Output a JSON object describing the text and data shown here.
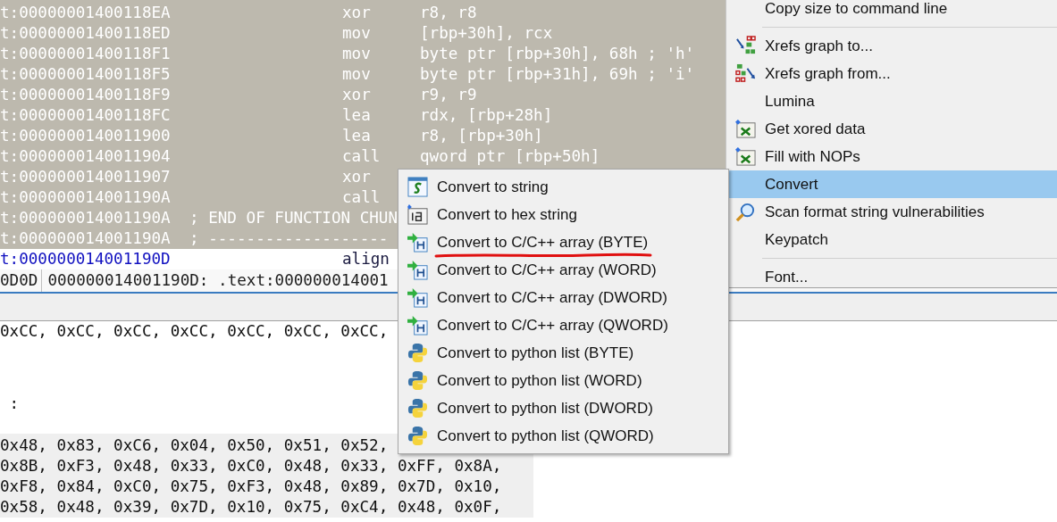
{
  "listing": {
    "rows": [
      {
        "address": "t:00000001400118EA",
        "mnemonic": "xor",
        "operands": "r8, r8",
        "selected": false
      },
      {
        "address": "t:00000001400118ED",
        "mnemonic": "mov",
        "operands": "[rbp+30h], rcx",
        "selected": false
      },
      {
        "address": "t:00000001400118F1",
        "mnemonic": "mov",
        "operands": "byte ptr [rbp+30h], 68h ; 'h'",
        "selected": false
      },
      {
        "address": "t:00000001400118F5",
        "mnemonic": "mov",
        "operands": "byte ptr [rbp+31h], 69h ; 'i'",
        "selected": false
      },
      {
        "address": "t:00000001400118F9",
        "mnemonic": "xor",
        "operands": "r9, r9",
        "selected": false
      },
      {
        "address": "t:00000001400118FC",
        "mnemonic": "lea",
        "operands": "rdx, [rbp+28h]",
        "selected": false
      },
      {
        "address": "t:0000000140011900",
        "mnemonic": "lea",
        "operands": "r8, [rbp+30h]",
        "selected": false
      },
      {
        "address": "t:0000000140011904",
        "mnemonic": "call",
        "operands": "qword ptr [rbp+50h]",
        "selected": false
      },
      {
        "address": "t:0000000140011907",
        "mnemonic": "xor",
        "selected": false
      },
      {
        "address": "t:000000014001190A",
        "mnemonic": "call",
        "selected": false
      },
      {
        "address": "t:000000014001190A",
        "comment": "; END OF FUNCTION CHUN",
        "selected": false
      },
      {
        "address": "t:000000014001190A",
        "comment": "; -------------------",
        "selected": false
      },
      {
        "address": "t:000000014001190D",
        "mnemonic": "align",
        "selected": true
      }
    ]
  },
  "status_line": {
    "offset": "0D0D",
    "location": "000000014001190D: .text:000000014001"
  },
  "output": {
    "lines": [
      "0xCC, 0xCC, 0xCC, 0xCC, 0xCC, 0xCC, 0xCC,",
      " :"
    ],
    "hex_rows": [
      "0x48, 0x83, 0xC6, 0x04, 0x50, 0x51, 0x52,",
      "0x8B, 0xF3, 0x48, 0x33, 0xC0, 0x48, 0x33, 0xFF, 0x8A,",
      "0xF8, 0x84, 0xC0, 0x75, 0xF3, 0x48, 0x89, 0x7D, 0x10,",
      "0x58, 0x48, 0x39, 0x7D, 0x10, 0x75, 0xC4, 0x48, 0x0F,"
    ]
  },
  "context_menu": {
    "items": [
      {
        "kind": "plain",
        "label": "Copy size to command line",
        "selected": false
      },
      {
        "kind": "separator"
      },
      {
        "kind": "graph_to",
        "label": "Xrefs graph to...",
        "selected": false
      },
      {
        "kind": "graph_from",
        "label": "Xrefs graph from...",
        "selected": false
      },
      {
        "kind": "plain",
        "label": "Lumina",
        "selected": false
      },
      {
        "kind": "patch",
        "label": "Get xored data",
        "selected": false
      },
      {
        "kind": "patch",
        "label": "Fill with NOPs",
        "selected": false
      },
      {
        "kind": "plain",
        "label": "Convert",
        "selected": true
      },
      {
        "kind": "search",
        "label": "Scan format string vulnerabilities",
        "selected": false
      },
      {
        "kind": "plain",
        "label": "Keypatch",
        "selected": false
      },
      {
        "kind": "separator"
      },
      {
        "kind": "plain",
        "label": "Font...",
        "selected": false
      }
    ]
  },
  "submenu": {
    "items": [
      {
        "kind": "string",
        "label": "Convert to string",
        "underlined": false
      },
      {
        "kind": "hex",
        "label": "Convert to hex string",
        "underlined": false
      },
      {
        "kind": "array",
        "label": "Convert to C/C++ array (BYTE)",
        "underlined": true
      },
      {
        "kind": "array",
        "label": "Convert to C/C++ array (WORD)",
        "underlined": false
      },
      {
        "kind": "array",
        "label": "Convert to C/C++ array (DWORD)",
        "underlined": false
      },
      {
        "kind": "array",
        "label": "Convert to C/C++ array (QWORD)",
        "underlined": false
      },
      {
        "kind": "python",
        "label": "Convert to python list (BYTE)",
        "underlined": false
      },
      {
        "kind": "python",
        "label": "Convert to python list (WORD)",
        "underlined": false
      },
      {
        "kind": "python",
        "label": "Convert to python list (DWORD)",
        "underlined": false
      },
      {
        "kind": "python",
        "label": "Convert to python list (QWORD)",
        "underlined": false
      }
    ]
  }
}
